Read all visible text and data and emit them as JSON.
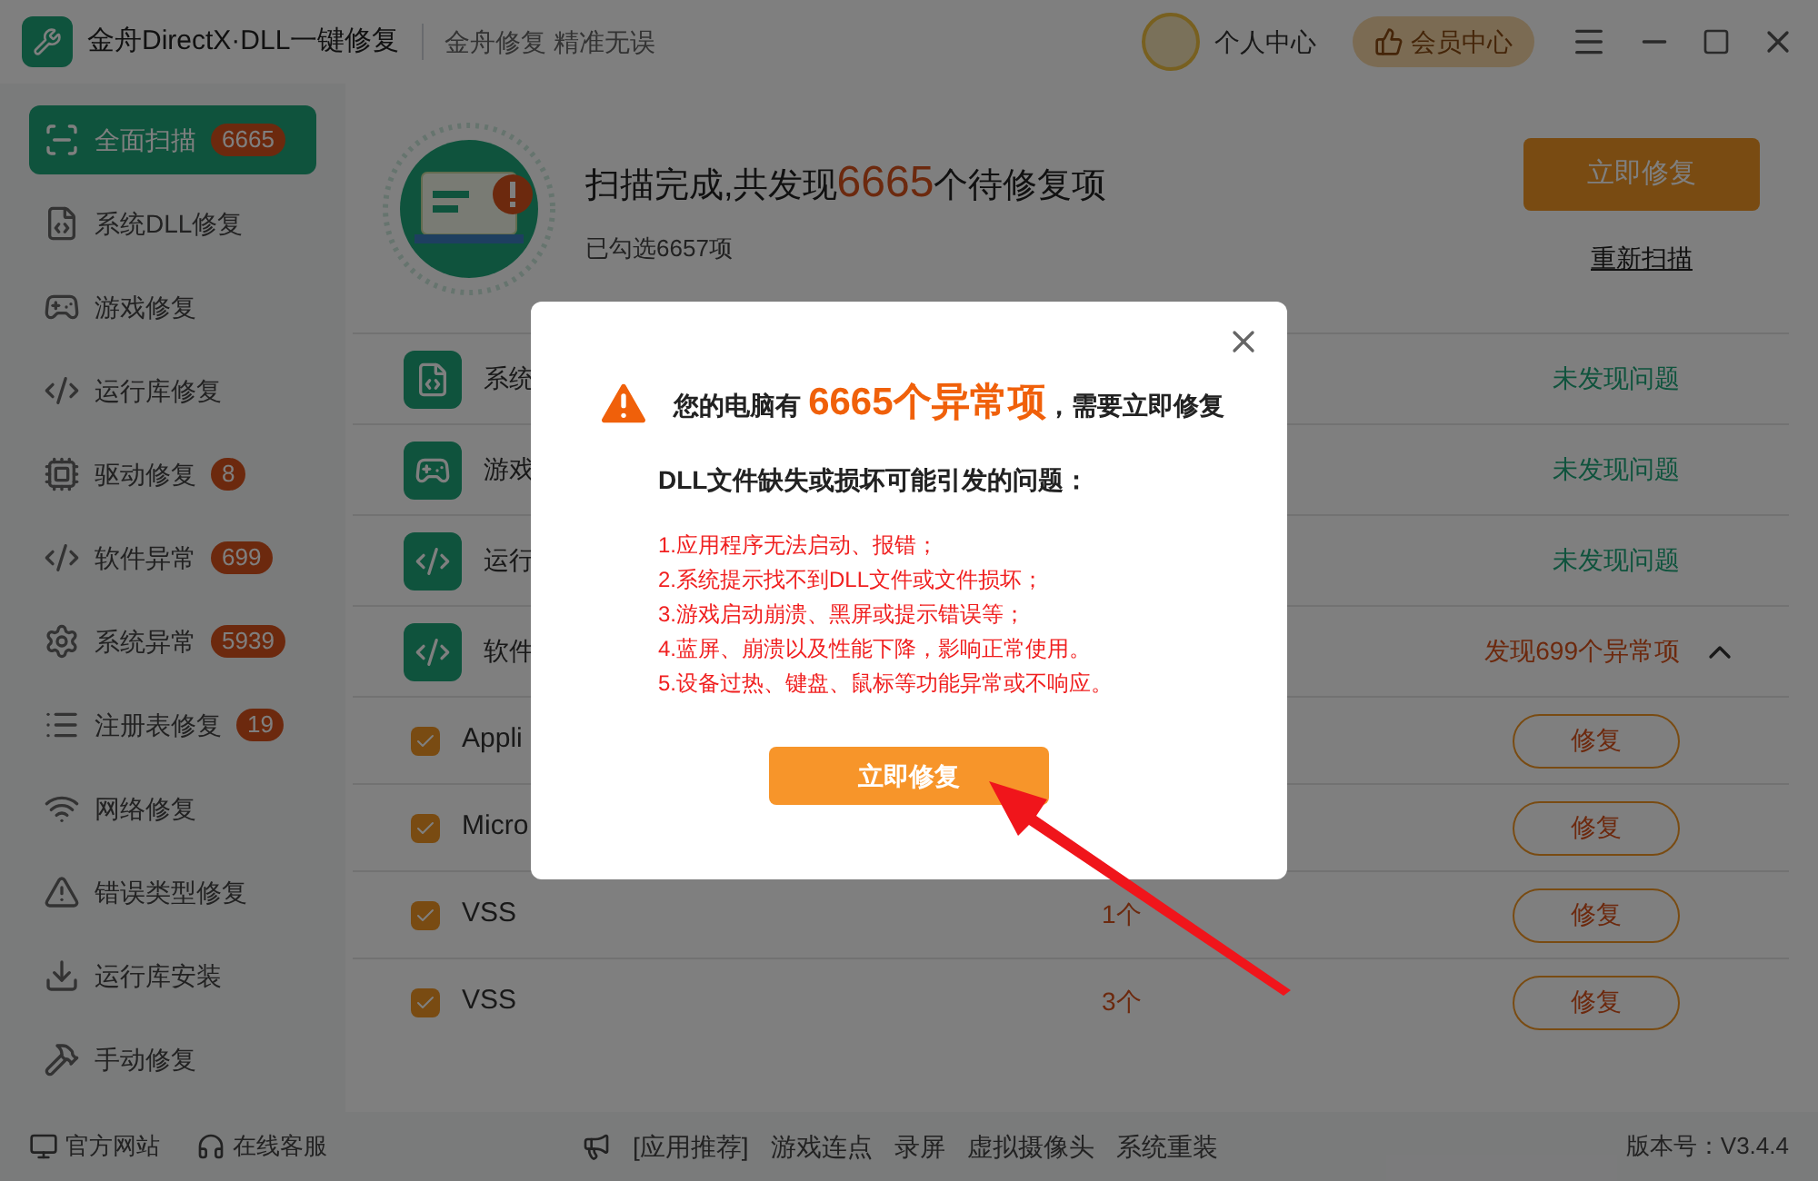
{
  "window": {
    "title": "金舟DirectX·DLL一键修复",
    "slogan": "金舟修复 精准无误",
    "user_label": "个人中心",
    "vip_button": "会员中心"
  },
  "sidebar": {
    "items": [
      {
        "label": "全面扫描",
        "badge": "6665",
        "selected": true
      },
      {
        "label": "系统DLL修复",
        "selected": false
      },
      {
        "label": "游戏修复",
        "selected": false
      },
      {
        "label": "运行库修复",
        "selected": false
      },
      {
        "label": "驱动修复",
        "badge": "8",
        "selected": false
      },
      {
        "label": "软件异常",
        "badge": "699",
        "selected": false
      },
      {
        "label": "系统异常",
        "badge": "5939",
        "selected": false
      },
      {
        "label": "注册表修复",
        "badge": "19",
        "selected": false
      },
      {
        "label": "网络修复",
        "selected": false
      },
      {
        "label": "错误类型修复",
        "selected": false
      },
      {
        "label": "运行库安装",
        "selected": false
      },
      {
        "label": "手动修复",
        "selected": false
      }
    ]
  },
  "scan": {
    "title_prefix": "扫描完成,共发现",
    "count": "6665",
    "title_suffix": "个待修复项",
    "selected_note": "已勾选6657项",
    "fix_button": "立即修复",
    "rescan_link": "重新扫描"
  },
  "categories": [
    {
      "name": "系统",
      "kind": "ok",
      "status": "未发现问题",
      "expanded": false
    },
    {
      "name": "游戏",
      "kind": "ok",
      "status": "未发现问题",
      "expanded": false
    },
    {
      "name": "运行",
      "kind": "ok",
      "status": "未发现问题",
      "expanded": false
    },
    {
      "name": "软件",
      "kind": "found",
      "status": "发现699个异常项",
      "expanded": true
    }
  ],
  "items": [
    {
      "name": "Appli",
      "checked": true,
      "button": "修复"
    },
    {
      "name": "Micro",
      "checked": true,
      "button": "修复"
    },
    {
      "name": "VSS",
      "count": "1个",
      "checked": true,
      "button": "修复"
    },
    {
      "name": "VSS",
      "count": "3个",
      "checked": true,
      "button": "修复"
    }
  ],
  "footer": {
    "links": [
      "官方网站",
      "在线客服"
    ],
    "recommend": [
      "[应用推荐]",
      "游戏连点",
      "录屏",
      "虚拟摄像头",
      "系统重装"
    ],
    "version": "版本号：V3.4.4"
  },
  "dialog": {
    "heading_prefix": "您的电脑有",
    "heading_highlight": "6665个异常项",
    "heading_suffix": "，需要立即修复",
    "subheading": "DLL文件缺失或损坏可能引发的问题：",
    "problems": [
      "1.应用程序无法启动、报错；",
      "2.系统提示找不到DLL文件或文件损坏；",
      "3.游戏启动崩溃、黑屏或提示错误等；",
      "4.蓝屏、崩溃以及性能下降，影响正常使用。",
      "5.设备过热、键盘、鼠标等功能异常或不响应。"
    ],
    "button": "立即修复"
  }
}
